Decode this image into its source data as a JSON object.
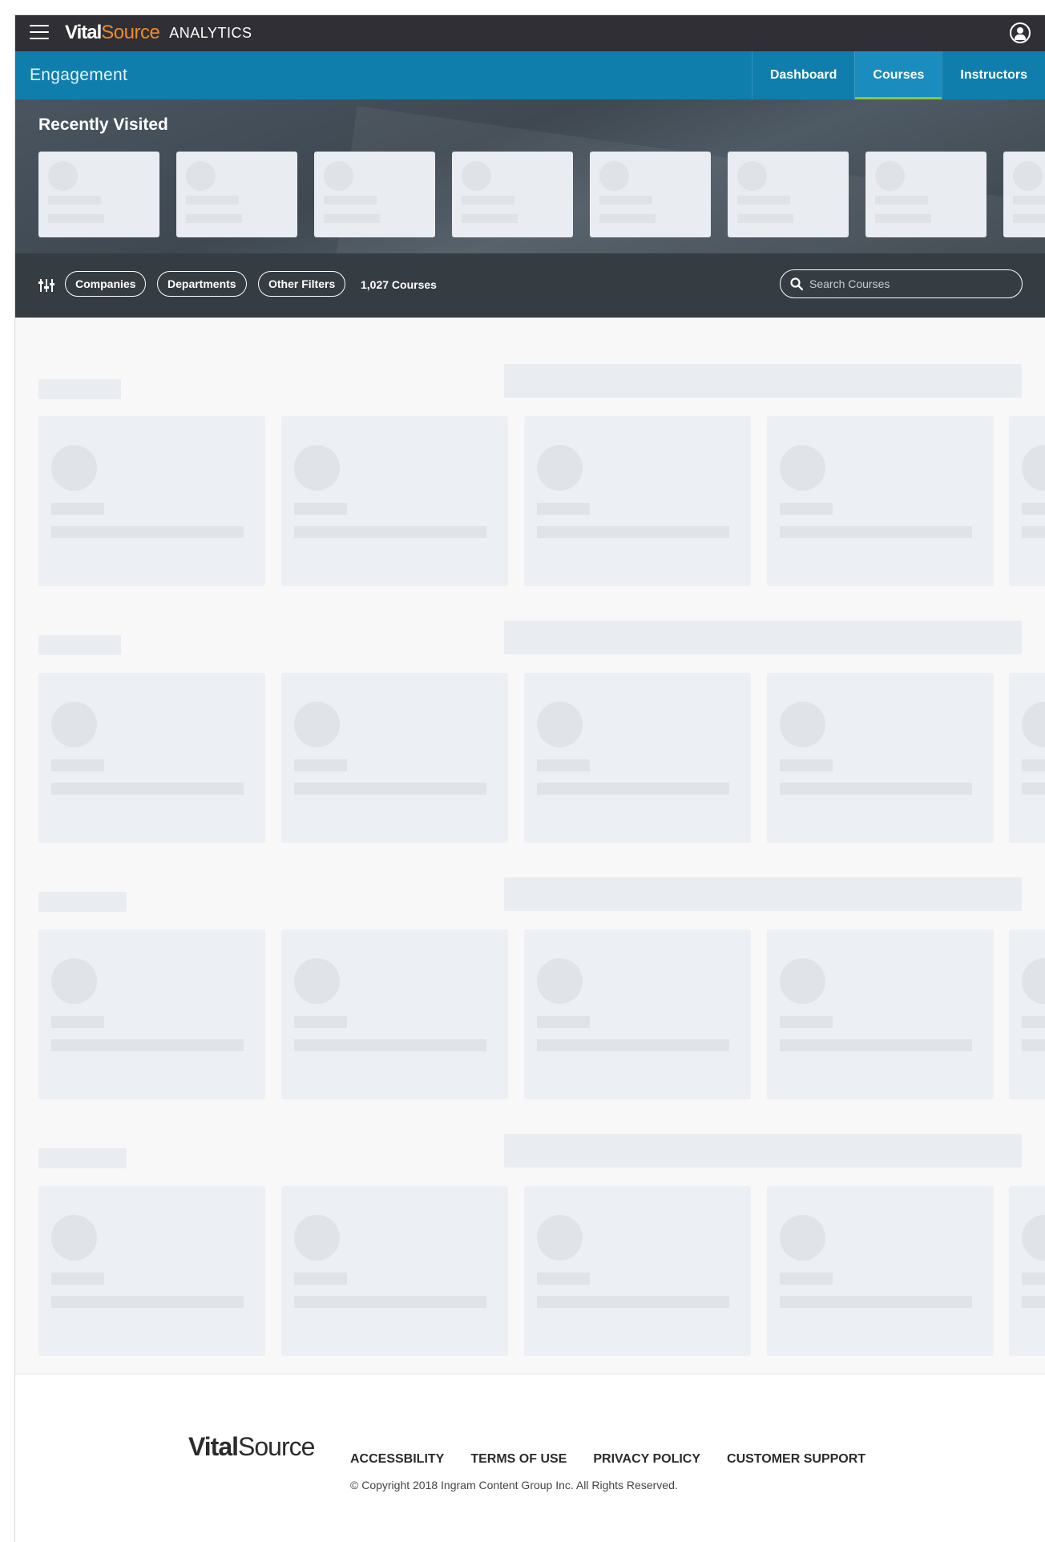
{
  "header": {
    "brand_vital": "Vital",
    "brand_source": "Source",
    "brand_product": "ANALYTICS",
    "menu_icon": "hamburger-icon",
    "user_icon": "user-circle-icon"
  },
  "nav": {
    "title": "Engagement",
    "tabs": [
      {
        "label": "Dashboard",
        "active": false
      },
      {
        "label": "Courses",
        "active": true
      },
      {
        "label": "Instructors",
        "active": false
      }
    ]
  },
  "recent": {
    "title": "Recently Visited"
  },
  "filters": {
    "icon": "sliders-icon",
    "chips": [
      "Companies",
      "Departments",
      "Other Filters"
    ],
    "count": "1,027 Courses",
    "search_placeholder": "Search Courses",
    "search_icon": "search-icon"
  },
  "footer": {
    "logo_vital": "Vital",
    "logo_source": "Source",
    "links": [
      "ACCESSBILITY",
      "TERMS OF USE",
      "PRIVACY POLICY",
      "CUSTOMER SUPPORT"
    ],
    "copyright": "© Copyright 2018 Ingram Content Group Inc. All Rights Reserved."
  },
  "colors": {
    "topbar": "#2f2f35",
    "nav": "#0f7ead",
    "accent_orange": "#f08a24",
    "active_tab_underline": "#8cc63f"
  }
}
